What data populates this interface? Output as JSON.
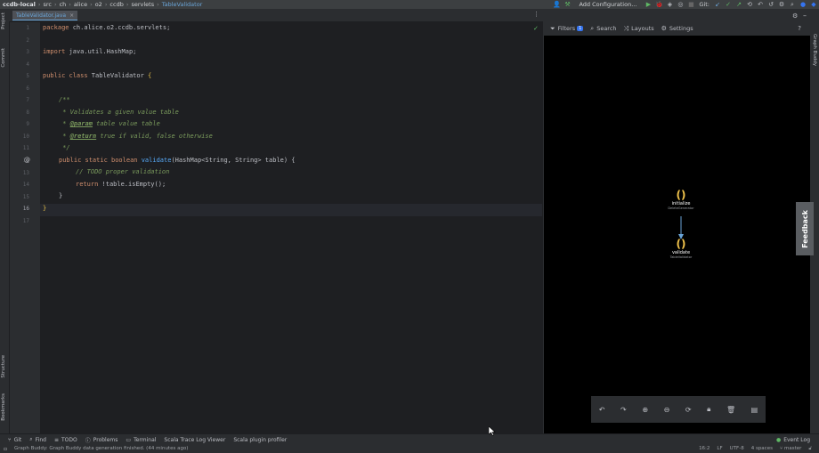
{
  "breadcrumb": [
    "ccdb-local",
    "src",
    "ch",
    "alice",
    "o2",
    "ccdb",
    "servlets",
    "TableValidator"
  ],
  "toolbar": {
    "run_config": "Add Configuration...",
    "git_label": "Git:"
  },
  "editor": {
    "tab_title": "TableValidator.java",
    "lines": [
      {
        "n": "1"
      },
      {
        "n": "2"
      },
      {
        "n": "3"
      },
      {
        "n": "4"
      },
      {
        "n": "5"
      },
      {
        "n": "6"
      },
      {
        "n": "7"
      },
      {
        "n": "8"
      },
      {
        "n": "9"
      },
      {
        "n": "10"
      },
      {
        "n": "11"
      },
      {
        "n": "12"
      },
      {
        "n": "13"
      },
      {
        "n": "14"
      },
      {
        "n": "15"
      },
      {
        "n": "16"
      },
      {
        "n": "17"
      }
    ],
    "code": {
      "l1_kw": "package ",
      "l1_rest": "ch.alice.o2.ccdb.servlets;",
      "l3_kw": "import ",
      "l3_rest": "java.util.HashMap;",
      "l5_kw": "public class ",
      "l5_name": "TableValidator ",
      "l5_brace": "{",
      "l7": "/**",
      "l8": " * Validates a given value table",
      "l9_pre": " * ",
      "l9_tag": "@param",
      "l9_rest": " table value table",
      "l10_pre": " * ",
      "l10_tag": "@return",
      "l10_rest": " true if valid, false otherwise",
      "l11": " */",
      "l12_kw": "public static boolean ",
      "l12_fn": "validate",
      "l12_rest": "(HashMap<String, String> table) {",
      "l13": "// TODO proper validation",
      "l14_kw": "return ",
      "l14_rest": "!table.isEmpty();",
      "l15": "}",
      "l16": "}"
    },
    "gutter_marker": "@"
  },
  "right_panel": {
    "tabs": [
      {
        "label": "Filters",
        "badge": "1",
        "icon": "filter-icon"
      },
      {
        "label": "Search",
        "icon": "search-icon"
      },
      {
        "label": "Layouts",
        "icon": "layouts-icon"
      },
      {
        "label": "Settings",
        "icon": "settings-icon"
      }
    ],
    "graph": {
      "nodes": [
        {
          "glyph": "()",
          "name": "initialize",
          "sub": "DeleteGenerator"
        },
        {
          "glyph": "()",
          "name": "validate",
          "sub": "TableValidator"
        }
      ]
    },
    "feedback_label": "Feedback",
    "side_label": "Graph Buddy"
  },
  "left_strip": {
    "top": [
      "Project",
      "Commit"
    ],
    "bottom": [
      "Structure",
      "Bookmarks"
    ]
  },
  "bottom_tabs": [
    {
      "label": "Git",
      "icon": "git-icon"
    },
    {
      "label": "Find",
      "icon": "search-icon"
    },
    {
      "label": "TODO",
      "icon": "todo-icon"
    },
    {
      "label": "Problems",
      "icon": "problems-icon"
    },
    {
      "label": "Terminal",
      "icon": "terminal-icon"
    },
    {
      "label": "Scala Trace Log Viewer",
      "icon": ""
    },
    {
      "label": "Scala plugin profiler",
      "icon": ""
    }
  ],
  "event_log": "Event Log",
  "status": {
    "message": "Graph Buddy: Graph Buddy data generation finished. (44 minutes ago)",
    "position": "16:2",
    "line_sep": "LF",
    "encoding": "UTF-8",
    "indent": "4 spaces",
    "branch": "master"
  },
  "colors": {
    "accent": "#3574f0",
    "keyword": "#cf8e6d",
    "comment": "#7a9a5c",
    "function": "#56a8f5",
    "node_glyph": "#f0c24b"
  }
}
